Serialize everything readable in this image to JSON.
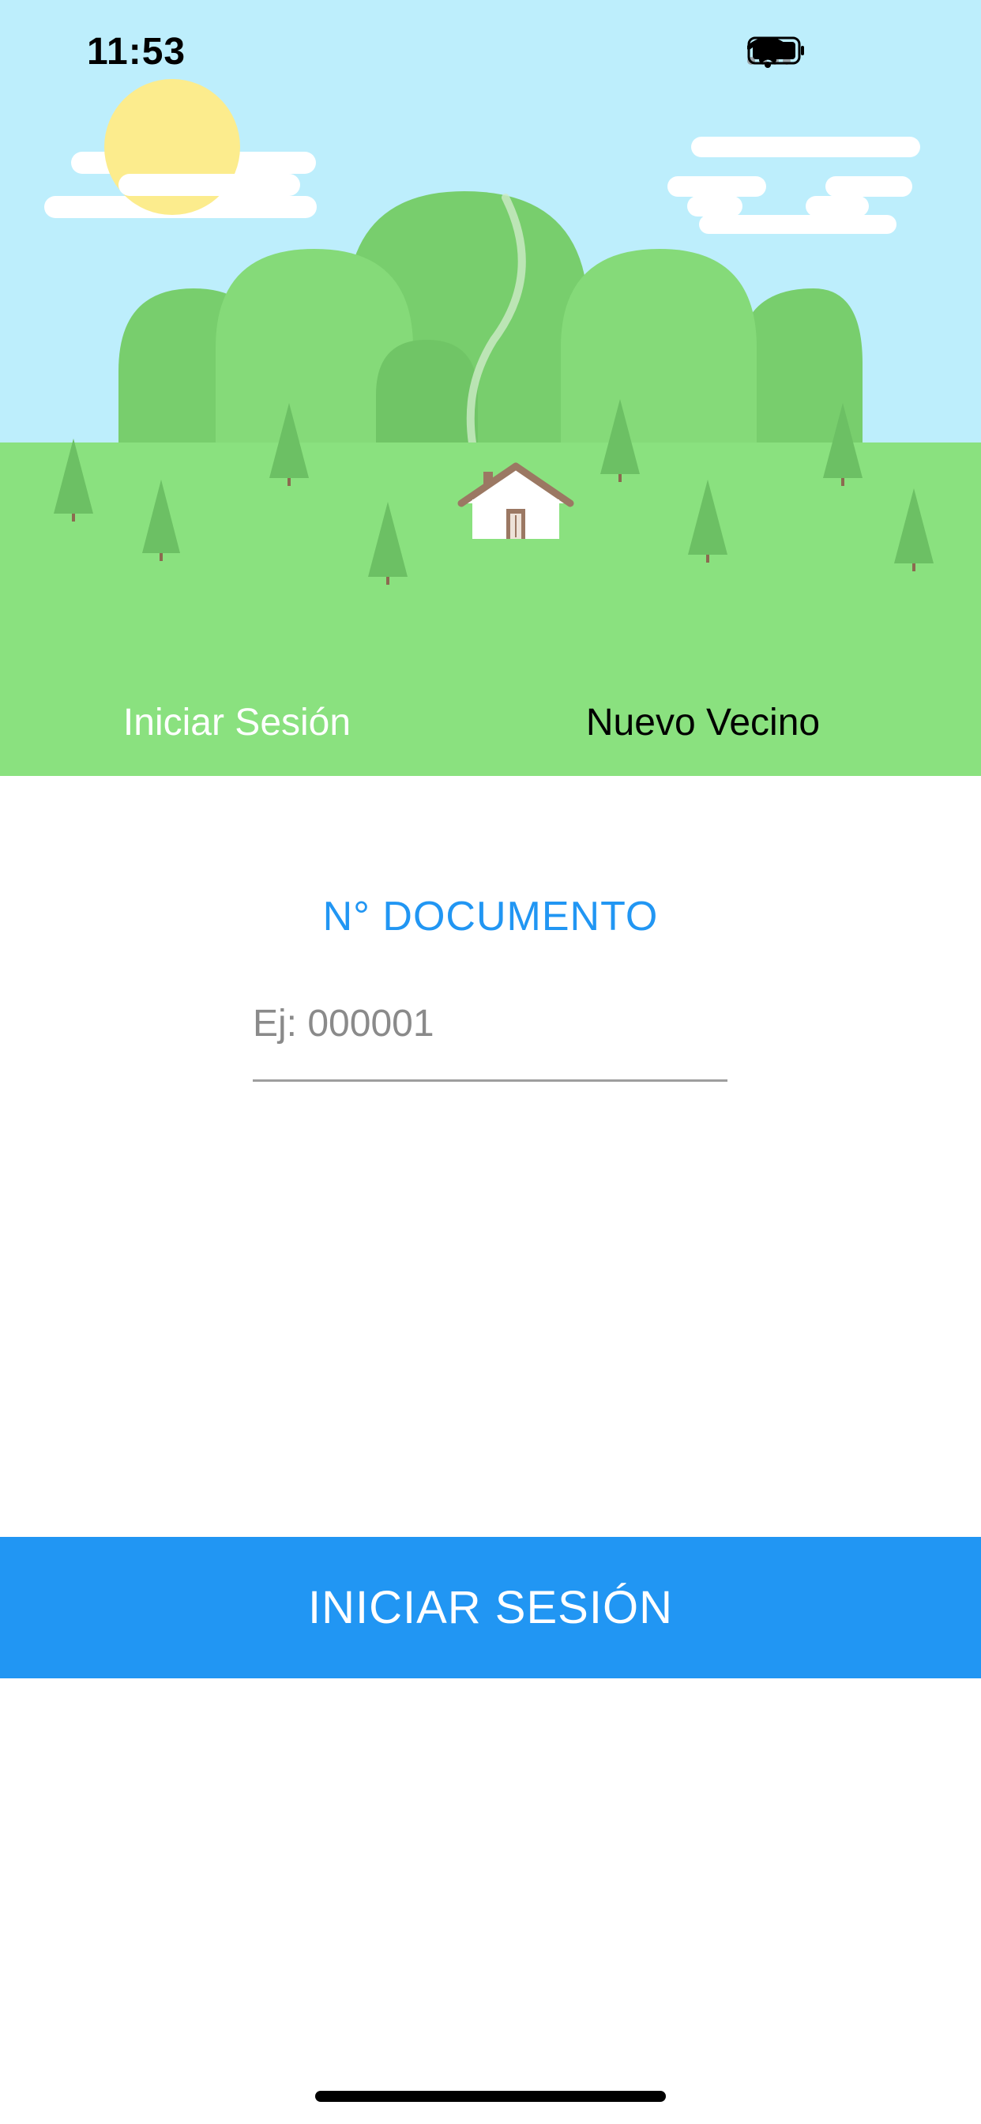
{
  "status_bar": {
    "time": "11:53"
  },
  "header": {
    "illustration": "sunny-landscape-with-hills-trees-and-house",
    "colors": {
      "sky": "#BDEEFC",
      "grass": "#8AE17F",
      "hill_light": "#85DA79",
      "hill_dark": "#78CE6D",
      "tree": "#6CC064",
      "sun": "#FCEC8D",
      "cloud": "#FFFFFF"
    }
  },
  "tabs": {
    "login_label": "Iniciar Sesión",
    "new_label": "Nuevo Vecino"
  },
  "form": {
    "document_label": "N° DOCUMENTO",
    "document_value": "",
    "document_placeholder": "Ej: 000001"
  },
  "actions": {
    "submit_label": "INICIAR SESIÓN"
  },
  "accent_color": "#2196F3"
}
